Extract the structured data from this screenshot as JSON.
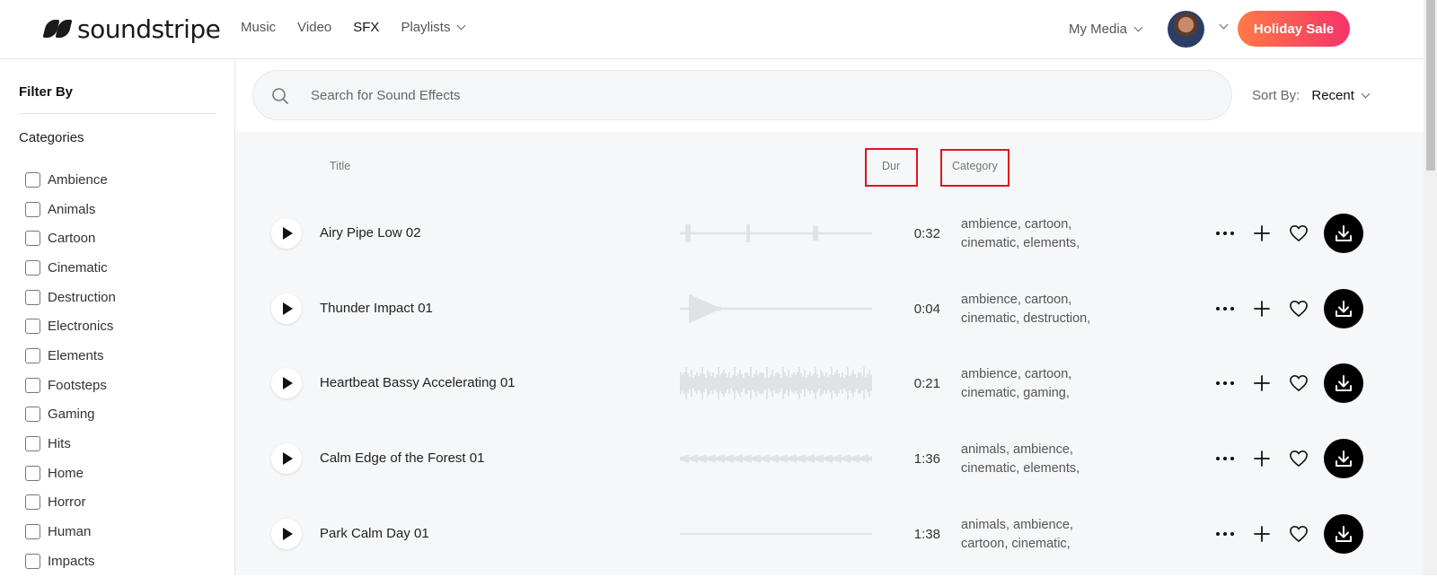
{
  "brand": {
    "name": "soundstripe"
  },
  "nav": {
    "items": [
      {
        "label": "Music"
      },
      {
        "label": "Video"
      },
      {
        "label": "SFX"
      },
      {
        "label": "Playlists"
      }
    ],
    "my_media": "My Media",
    "sale_button": "Holiday Sale"
  },
  "sidebar": {
    "filter_title": "Filter By",
    "categories_title": "Categories",
    "categories": [
      "Ambience",
      "Animals",
      "Cartoon",
      "Cinematic",
      "Destruction",
      "Electronics",
      "Elements",
      "Footsteps",
      "Gaming",
      "Hits",
      "Home",
      "Horror",
      "Human",
      "Impacts"
    ]
  },
  "search": {
    "placeholder": "Search for Sound Effects"
  },
  "sort": {
    "label": "Sort By:",
    "value": "Recent"
  },
  "columns": {
    "title": "Title",
    "duration": "Dur",
    "category": "Category"
  },
  "tracks": [
    {
      "title": "Airy Pipe Low 02",
      "duration": "0:32",
      "categories_line1": "ambience, cartoon,",
      "categories_line2": "cinematic, elements,"
    },
    {
      "title": "Thunder Impact 01",
      "duration": "0:04",
      "categories_line1": "ambience, cartoon,",
      "categories_line2": "cinematic, destruction,"
    },
    {
      "title": "Heartbeat Bassy Accelerating 01",
      "duration": "0:21",
      "categories_line1": "ambience, cartoon,",
      "categories_line2": "cinematic, gaming,"
    },
    {
      "title": "Calm Edge of the Forest 01",
      "duration": "1:36",
      "categories_line1": "animals, ambience,",
      "categories_line2": "cinematic, elements,"
    },
    {
      "title": "Park Calm Day 01",
      "duration": "1:38",
      "categories_line1": "animals, ambience,",
      "categories_line2": "cartoon, cinematic,"
    }
  ],
  "colors": {
    "sale_start": "#ff7a45",
    "sale_end": "#f5336a",
    "highlight_box": "#e0141e"
  }
}
